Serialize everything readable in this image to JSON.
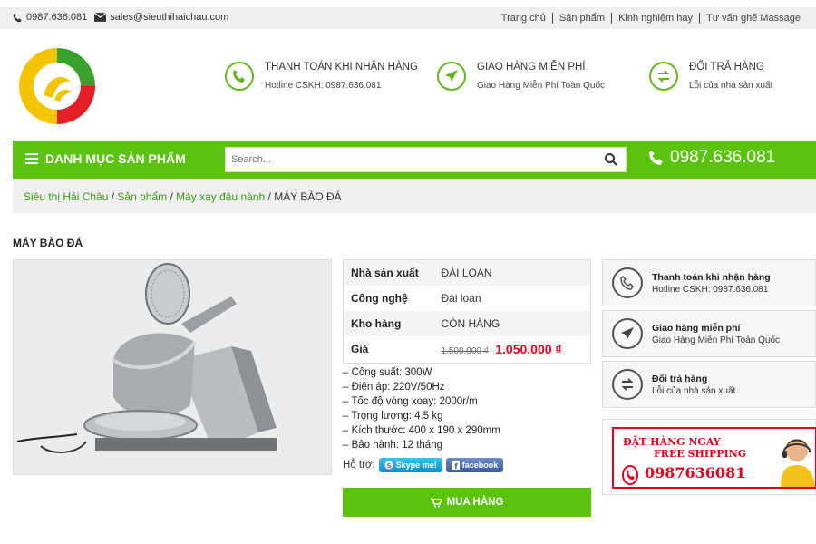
{
  "topbar": {
    "phone": "0987.636.081",
    "email": "sales@sieuthihaichau.com",
    "links": [
      "Trang chủ",
      "Sản phẩm",
      "Kinh nghiệm hay",
      "Tư vấn ghế Massage"
    ]
  },
  "header": {
    "features": [
      {
        "title": "THANH TOÁN KHI NHẬN HÀNG",
        "sub": "Hotline CSKH: 0987.636.081",
        "icon": "phone-icon"
      },
      {
        "title": "GIAO HÀNG MIỄN PHÍ",
        "sub": "Giao Hàng Miễn Phí Toàn Quốc",
        "icon": "plane-icon"
      },
      {
        "title": "ĐỔI TRẢ HÀNG",
        "sub": "Lỗi của nhà sản xuất",
        "icon": "exchange-icon"
      }
    ]
  },
  "nav": {
    "category_label": "DANH MỤC SẢN PHẨM",
    "search_placeholder": "Search...",
    "hotline": "0987.636.081"
  },
  "breadcrumb": {
    "items": [
      "Siêu thị Hải Châu",
      "Sản phẩm",
      "Máy xay đậu nành"
    ],
    "current": "MÁY BÀO ĐÁ",
    "separator": " / "
  },
  "product": {
    "title": "MÁY BÀO ĐÁ",
    "specs": [
      {
        "key": "Nhà sản xuất",
        "value": "ĐÀI LOAN"
      },
      {
        "key": "Công nghệ",
        "value": "Đài loan"
      },
      {
        "key": "Kho hàng",
        "value": "CÒN HÀNG"
      }
    ],
    "price_label": "Giá",
    "old_price": "1.500.000 ₫",
    "new_price": "1.050.000 ₫",
    "features": [
      "– Công suất: 300W",
      "– Điện áp: 220V/50Hz",
      "– Tốc độ vòng xoay: 2000r/m",
      "– Trọng lượng: 4.5 kg",
      "– Kích thước: 400 x 190 x 290mm",
      "– Bảo hành: 12 tháng"
    ],
    "support_label": "Hỗ trợ:",
    "skype_label": "Skype me!",
    "facebook_label": "facebook",
    "buy_label": "MUA HÀNG"
  },
  "sidebar": {
    "boxes": [
      {
        "title": "Thanh toán khi nhận hàng",
        "sub": "Hotline CSKH: 0987.636.081"
      },
      {
        "title": "Giao hàng miễn phí",
        "sub": "Giao Hàng Miễn Phí Toàn Quốc"
      },
      {
        "title": "Đổi trả hàng",
        "sub": "Lỗi của nhà sản xuất"
      }
    ],
    "promo": {
      "line1": "ĐẶT HÀNG NGAY",
      "line2": "FREE SHIPPING",
      "phone": "0987636081"
    }
  },
  "colors": {
    "brand_green": "#5bc20d",
    "price_red": "#e3001b",
    "link_green": "#3a9a17"
  }
}
